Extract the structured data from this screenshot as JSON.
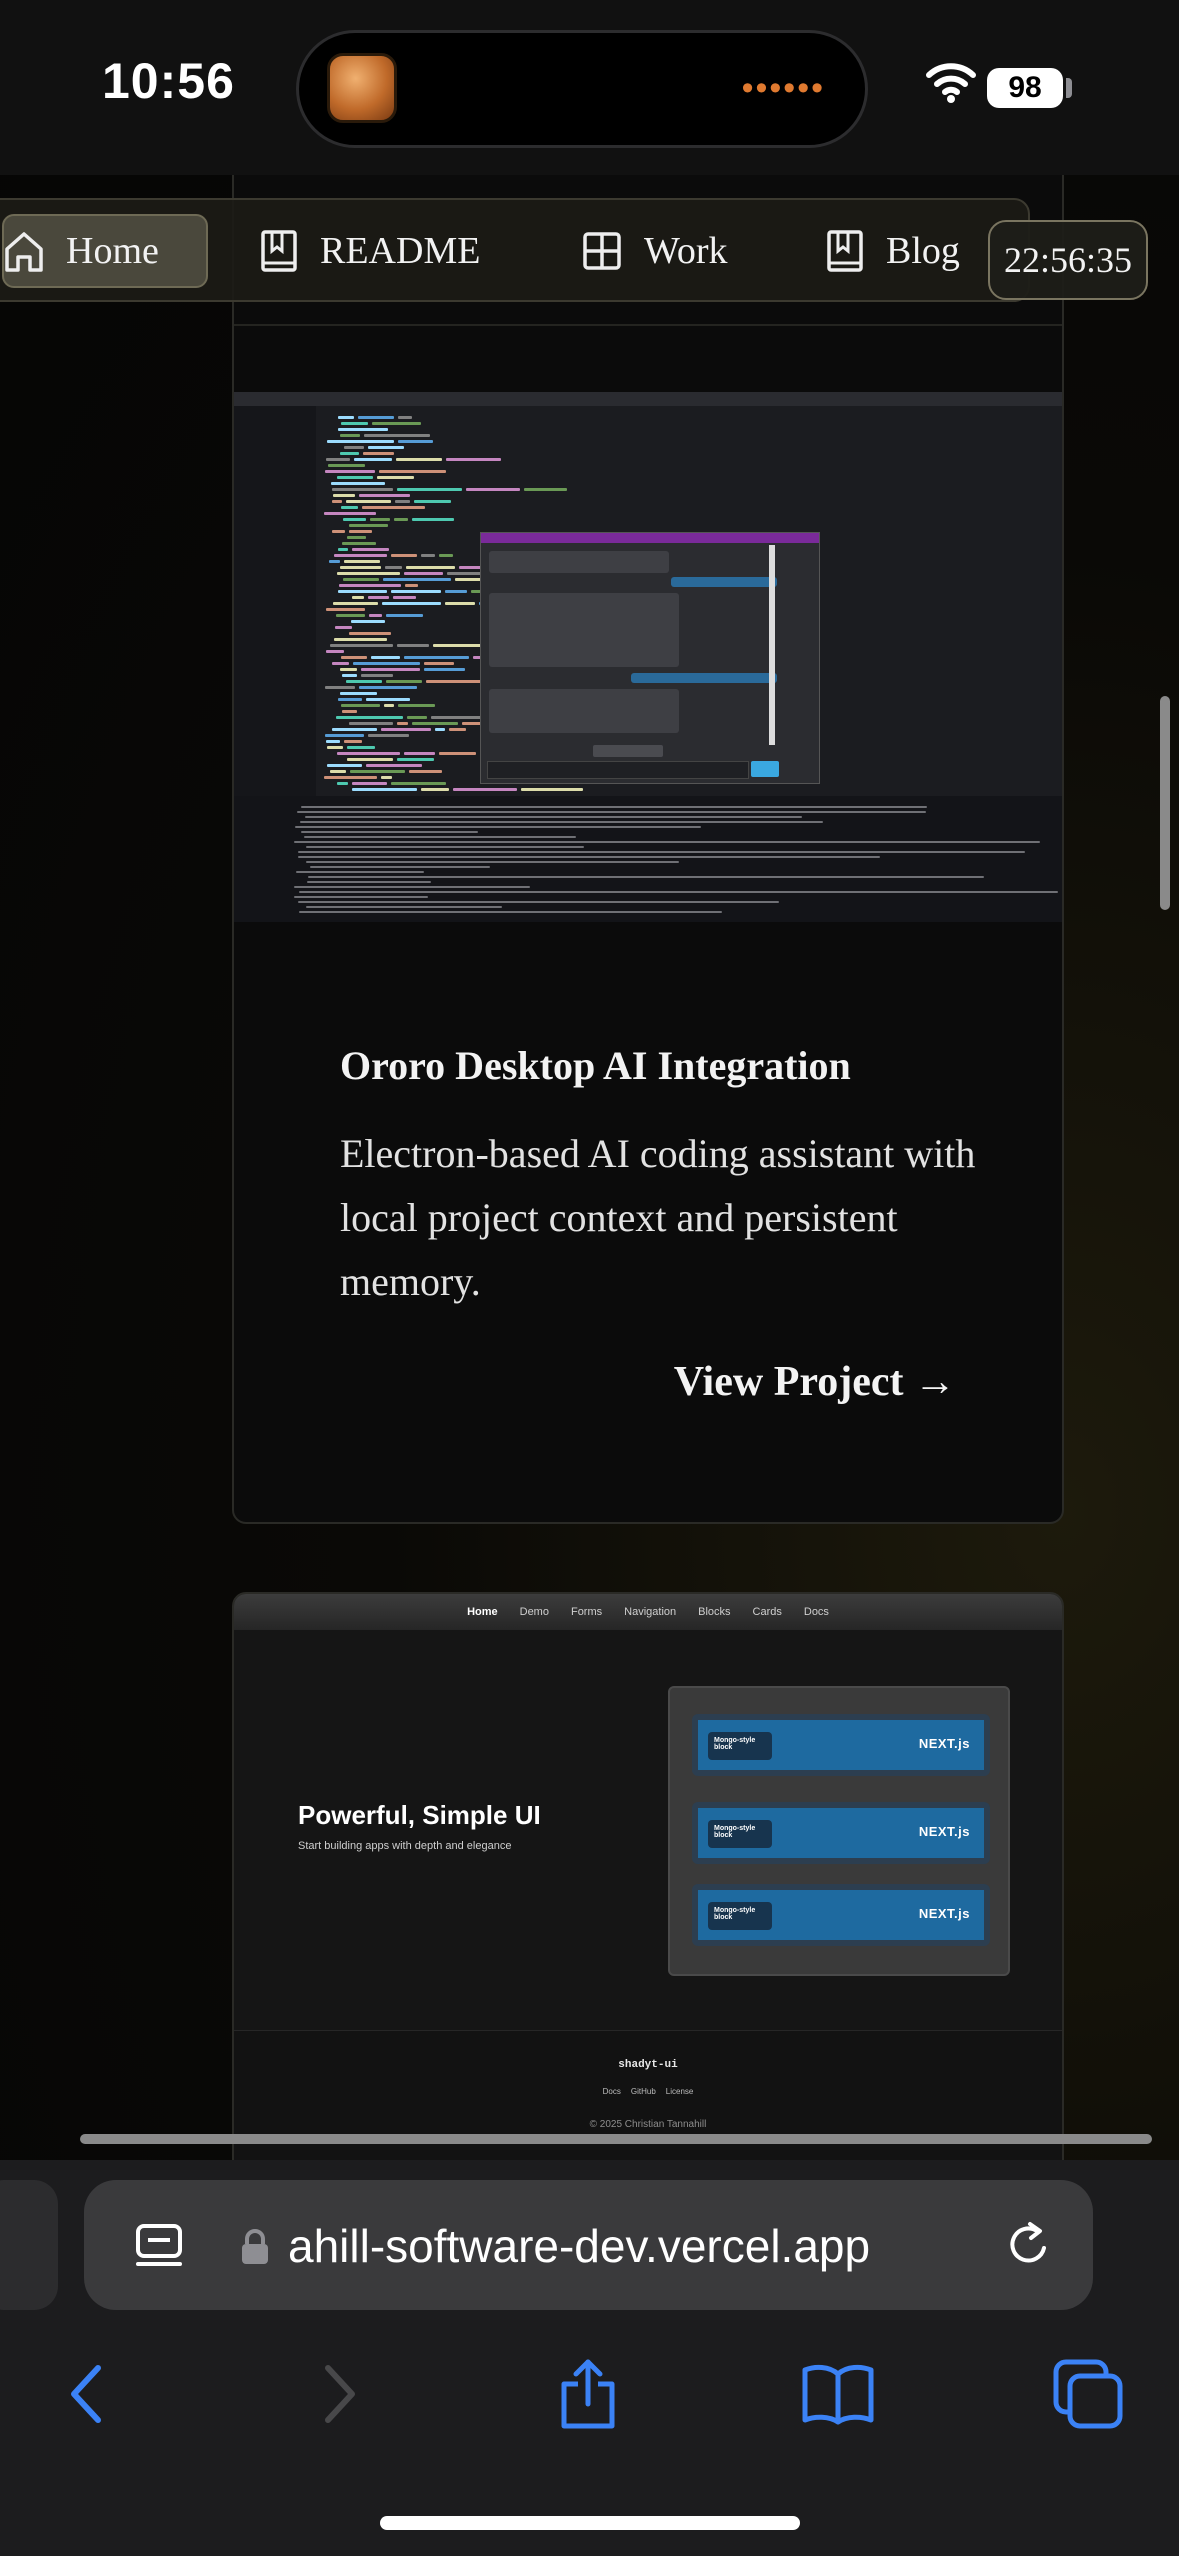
{
  "status_bar": {
    "time": "10:56",
    "battery": "98",
    "island_indicator": "••••••",
    "icons": [
      "app-thumbnail-icon",
      "wifi-icon",
      "battery-icon"
    ]
  },
  "nav": {
    "items": [
      {
        "label": "Home",
        "icon": "home-icon",
        "active": true
      },
      {
        "label": "README",
        "icon": "book-icon"
      },
      {
        "label": "Work",
        "icon": "grid-icon"
      },
      {
        "label": "Blog",
        "icon": "book-icon"
      }
    ],
    "clock": "22:56:35"
  },
  "projects": [
    {
      "title": "Ororo Desktop AI Integration",
      "description": "Electron-based AI coding assistant with local project context and persistent memory.",
      "link_label": "View Project →"
    }
  ],
  "preview2": {
    "nav": [
      "Home",
      "Demo",
      "Forms",
      "Navigation",
      "Blocks",
      "Cards",
      "Docs"
    ],
    "hero_title": "Powerful, Simple UI",
    "hero_subtitle": "Start building apps with depth and elegance",
    "block_label": "Mongo-style block",
    "block_logo": "NEXT.js",
    "footer_brand": "shadyt-ui",
    "footer_links": [
      "Docs",
      "GitHub",
      "License"
    ],
    "footer_copy": "© 2025 Christian Tannahill"
  },
  "browser": {
    "url": "ahill-software-dev.vercel.app",
    "icons": [
      "tab-overview-icon",
      "lock-icon",
      "reload-icon",
      "back-icon",
      "forward-icon",
      "share-icon",
      "bookmarks-icon",
      "tabs-icon"
    ]
  },
  "colors": {
    "accent_blue": "#3b82f6",
    "page_bg": "#0a0906",
    "toolbar_bg": "#1c1c1e"
  }
}
